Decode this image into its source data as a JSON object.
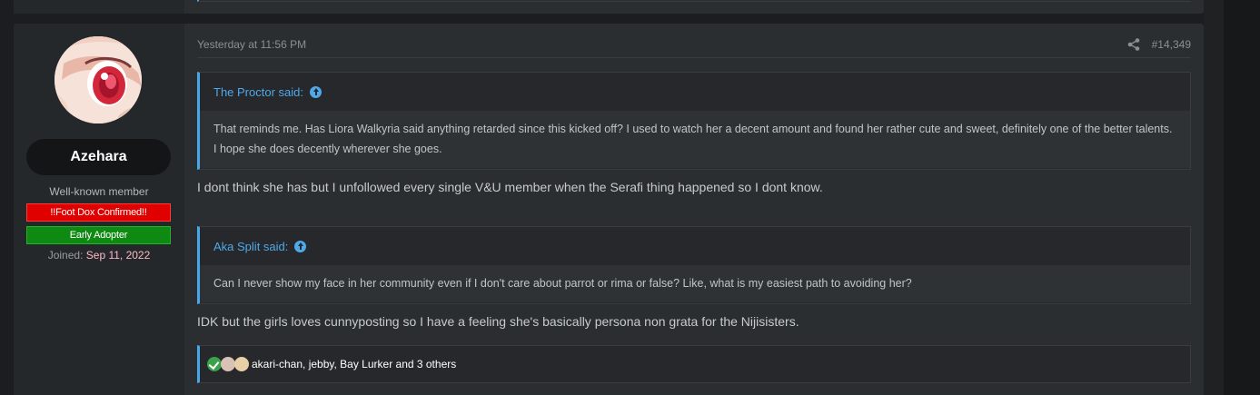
{
  "post": {
    "username": "Azehara",
    "user_title": "Well-known member",
    "banners": [
      {
        "label": "!!Foot Dox Confirmed!!",
        "color": "#e10000"
      },
      {
        "label": "Early Adopter",
        "color": "#0e8a12"
      }
    ],
    "joined_label": "Joined:",
    "joined_date": "Sep 11, 2022",
    "timestamp": "Yesterday at 11:56 PM",
    "post_number": "#14,349",
    "quotes": [
      {
        "author": "The Proctor said:",
        "text": "That reminds me. Has Liora Walkyria said anything retarded since this kicked off? I used to watch her a decent amount and found her rather cute and sweet, definitely one of the better talents. I hope she does decently wherever she goes."
      },
      {
        "author": "Aka Split said:",
        "text": "Can I never show my face in her community even if I don't care about parrot or rima or false? Like, what is my easiest path to avoiding her?"
      }
    ],
    "replies": [
      "I dont think she has but I unfollowed every single V&U member when the Serafi thing happened so I dont know.",
      "IDK but the girls loves cunnyposting so I have a feeling she's basically persona non grata for the Nijisisters."
    ],
    "reactions_text": "akari-chan, jebby, Bay Lurker and 3 others"
  },
  "colors": {
    "accent": "#47a7eb",
    "link": "#4ea9e8",
    "joined_date": "#ffb9c8"
  },
  "icons": [
    "share-icon",
    "jump-up-icon",
    "like-check-icon",
    "avatar-icon"
  ]
}
